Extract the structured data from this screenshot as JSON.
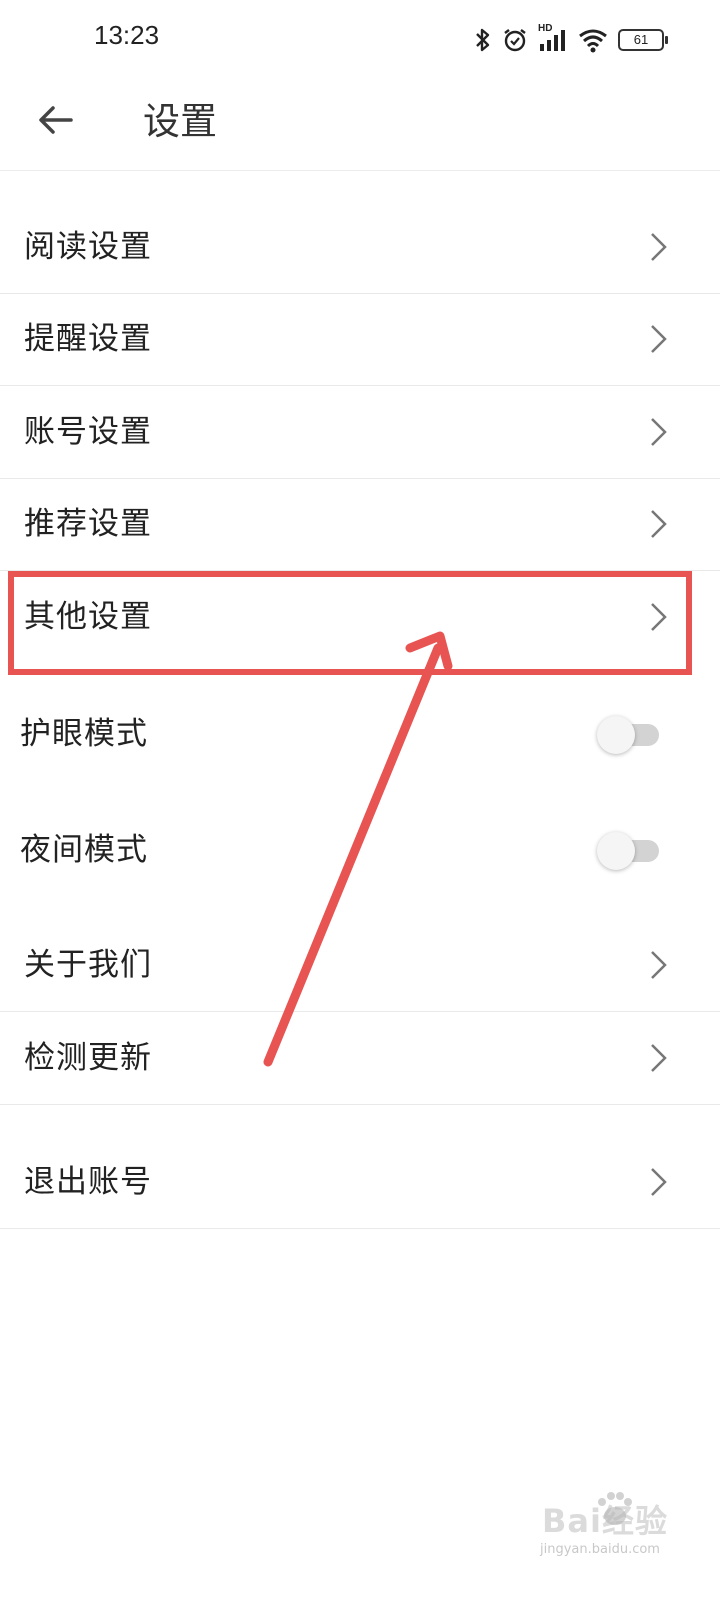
{
  "status_bar": {
    "time": "13:23",
    "hd_label": "HD",
    "battery_level": "61",
    "icons": [
      "bluetooth-icon",
      "alarm-icon",
      "signal-icon",
      "wifi-icon",
      "battery-icon"
    ]
  },
  "header": {
    "back_icon": "back-arrow-icon",
    "title": "设置"
  },
  "settings": {
    "reading": "阅读设置",
    "reminder": "提醒设置",
    "account": "账号设置",
    "recommend": "推荐设置",
    "other": "其他设置",
    "eye_care": "护眼模式",
    "eye_care_on": false,
    "night_mode": "夜间模式",
    "night_mode_on": false,
    "about": "关于我们",
    "check_update": "检测更新",
    "logout": "退出账号"
  },
  "annotation": {
    "highlight_color": "#e85451",
    "highlighted_item": "其他设置"
  },
  "watermark": {
    "brand": "Bai经验",
    "url": "jingyan.baidu.com"
  },
  "colors": {
    "text": "#222222",
    "divider": "#e9e9e9",
    "toggle_track": "#d3d3d3",
    "annotation": "#e85451"
  }
}
